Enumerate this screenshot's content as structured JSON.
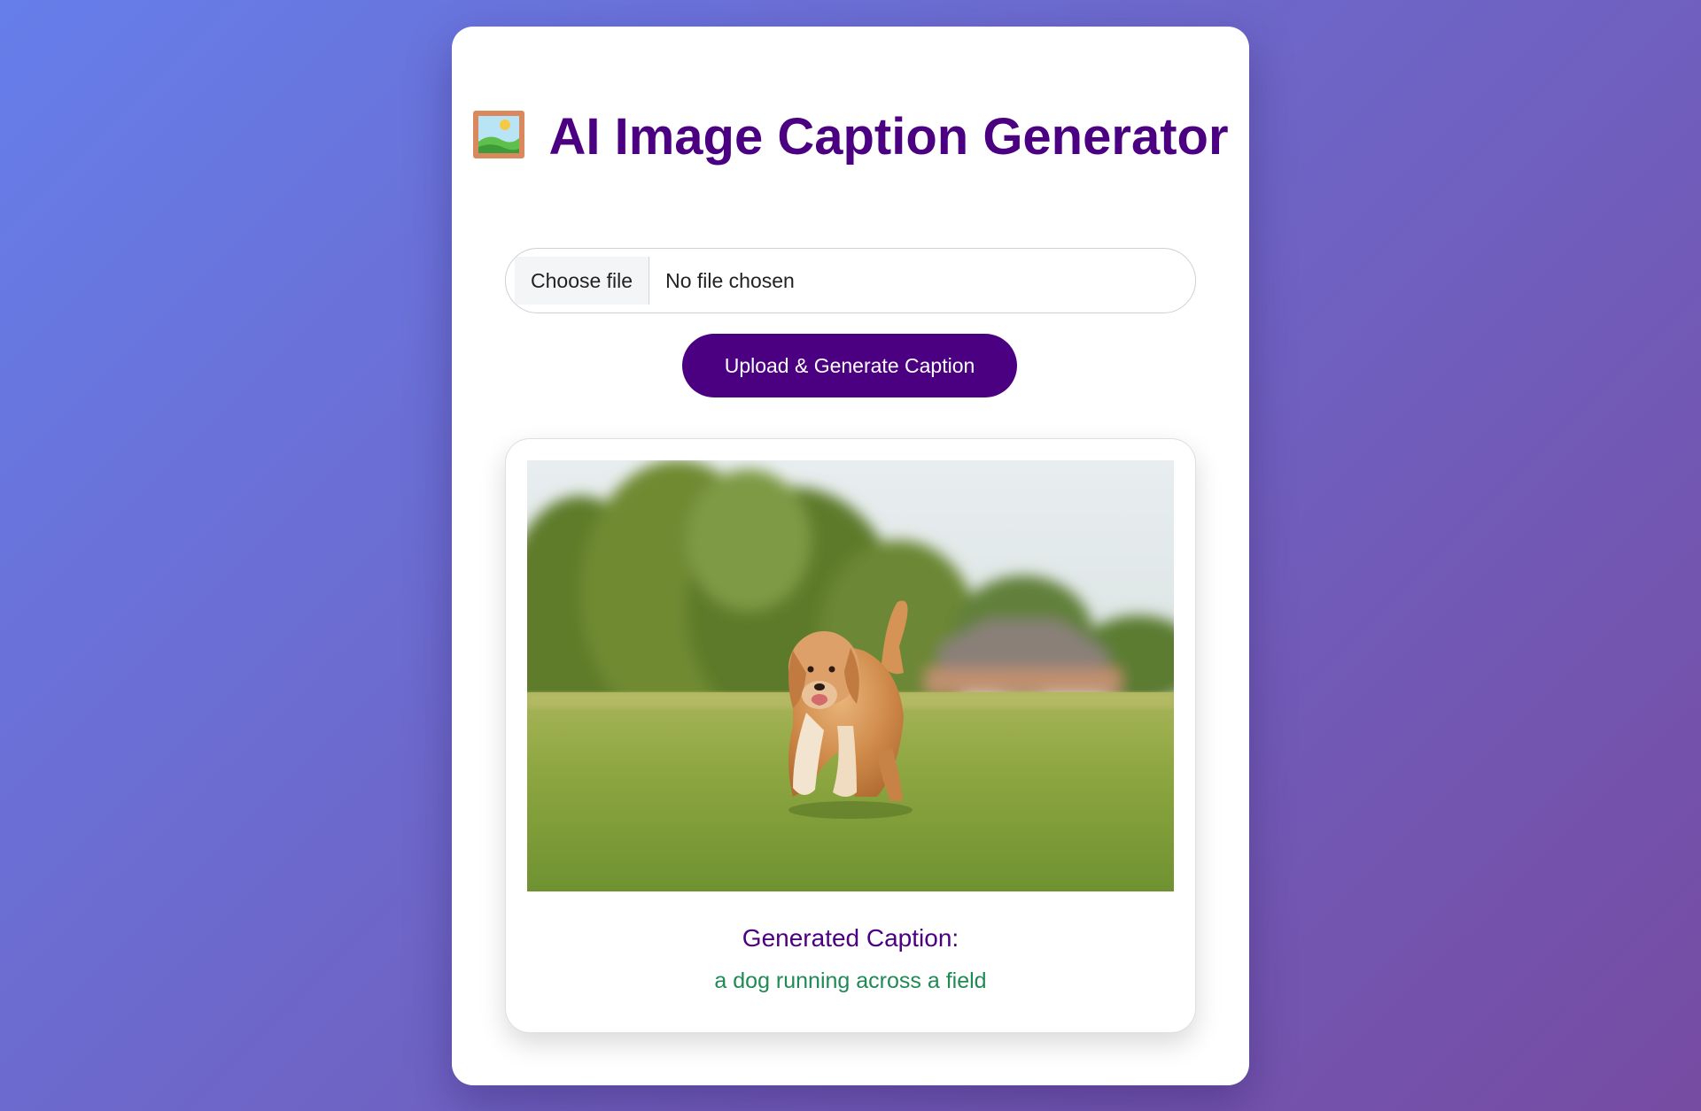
{
  "app": {
    "title": "AI Image Caption Generator",
    "title_icon": "framed-picture-icon"
  },
  "upload": {
    "choose_file_label": "Choose file",
    "file_status": "No file chosen",
    "submit_label": "Upload & Generate Caption"
  },
  "result": {
    "image_icon": "uploaded-dog-photo",
    "caption_heading": "Generated Caption:",
    "caption": "a dog running across a field"
  },
  "colors": {
    "gradient_start": "#667eea",
    "gradient_end": "#764ba2",
    "accent": "#4b0082",
    "caption_text": "#1f8a54",
    "card_background": "#ffffff"
  }
}
